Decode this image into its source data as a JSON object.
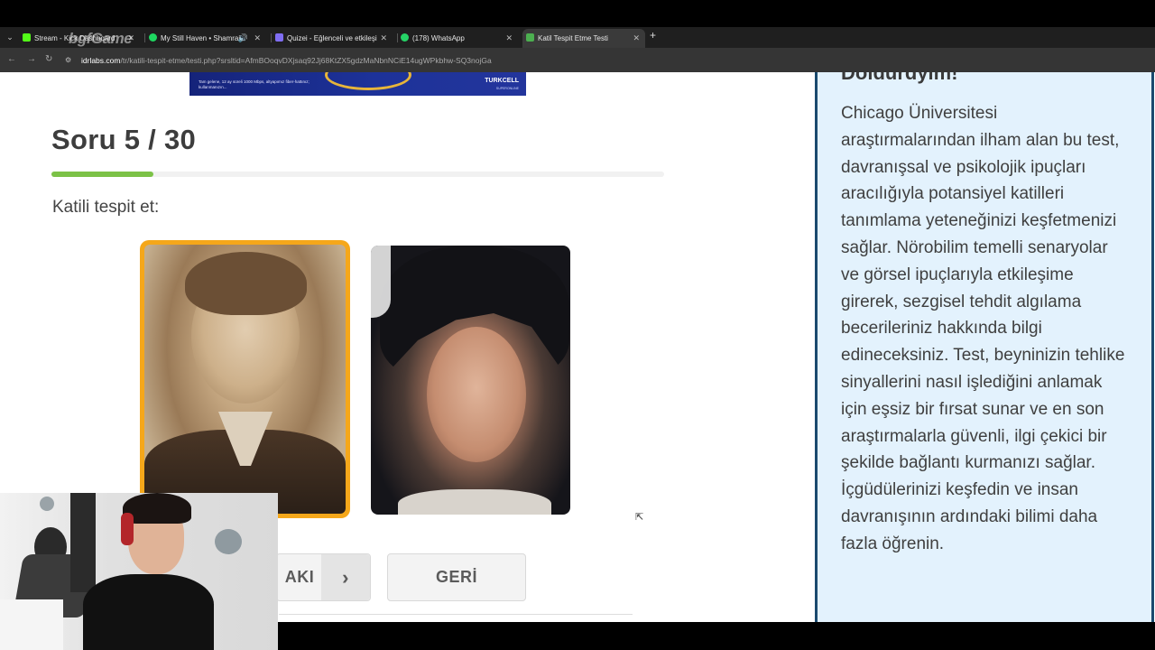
{
  "browser": {
    "tabs": [
      {
        "label": "Stream - Kick Dashboard",
        "icon_color": "#53fc18",
        "active": false
      },
      {
        "label": "My Still Haven • Shamrain",
        "icon_color": "#1ed760",
        "active": false
      },
      {
        "label": "Quizei - Eğlenceli ve etkileşimli",
        "icon_color": "#7f6df2",
        "active": false
      },
      {
        "label": "(178) WhatsApp",
        "icon_color": "#25d366",
        "active": false
      },
      {
        "label": "Katil Tespit Etme Testi",
        "icon_color": "#4caf50",
        "active": true
      }
    ],
    "url_host": "idrlabs.com",
    "url_path": "/tr/katili-tespit-etme/testi.php?srsltid=AfmBOoqvDXjsaq92Jj68KtZX5gdzMaNbnNCiE14ugWPkbhw-SQ3nojGa",
    "watermark": "bgfGame"
  },
  "ad": {
    "text": "Tam gelene, 12 ay süreli 1000 Mbps, altyapımız fiber-hattınız; kullanmanızın...",
    "brand": "TURKCELL",
    "brand_sub": "SUPERONLINE"
  },
  "quiz": {
    "title": "Soru 5 / 30",
    "progress_fraction": 0.1667,
    "prompt": "Katili tespit et:",
    "next_label": "AKI",
    "next_icon": "chevron-right-icon",
    "back_label": "GERİ"
  },
  "sidebar": {
    "heading": "Doldurdyim!",
    "body": "Chicago Üniversitesi araştırmalarından ilham alan bu test, davranışsal ve psikolojik ipuçları aracılığıyla potansiyel katilleri tanımlama yeteneğinizi keşfetmenizi sağlar. Nörobilim temelli senaryolar ve görsel ipuçlarıyla etkileşime girerek, sezgisel tehdit algılama becerileriniz hakkında bilgi edineceksiniz. Test, beyninizin tehlike sinyallerini nasıl işlediğini anlamak için eşsiz bir fırsat sunar ve en son araştırmalarla güvenli, ilgi çekici bir şekilde bağlantı kurmanızı sağlar. İçgüdülerinizi keşfedin ve insan davranışının ardındaki bilimi daha fazla öğrenin."
  },
  "colors": {
    "accent_selected": "#f5a71a",
    "progress": "#7cc247",
    "sidebar_bg": "#e3f2fd",
    "sidebar_border": "#1a4a6e"
  }
}
